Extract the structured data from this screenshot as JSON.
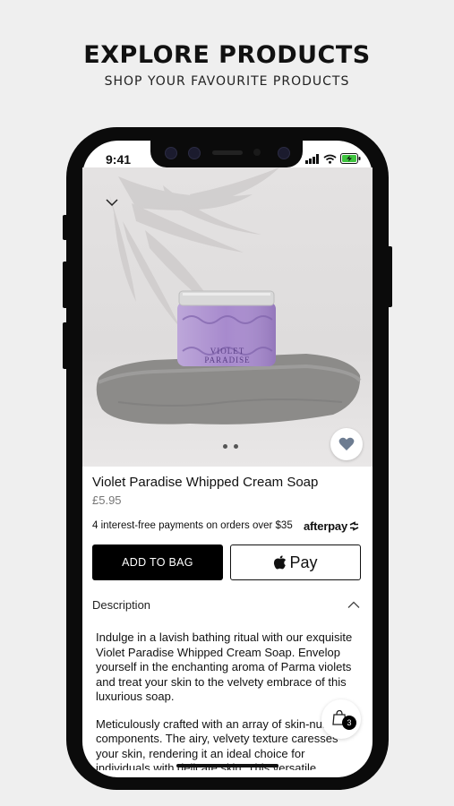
{
  "header": {
    "title": "EXPLORE PRODUCTS",
    "subtitle": "SHOP YOUR FAVOURITE PRODUCTS"
  },
  "status_bar": {
    "time": "9:41"
  },
  "product": {
    "name": "Violet Paradise Whipped Cream Soap",
    "price": "£5.95",
    "jar_label": "VIOLET PARADISE",
    "image_page_count": 2,
    "favorite": false
  },
  "afterpay": {
    "text": "4 interest-free payments on orders over $35",
    "logo": "afterpay"
  },
  "buttons": {
    "add_to_bag": "ADD TO BAG",
    "apple_pay": "Pay"
  },
  "description": {
    "label": "Description",
    "paragraphs": [
      "Indulge in a lavish bathing ritual with our exquisite Violet Paradise Whipped Cream Soap. Envelop yourself in the enchanting aroma of Parma violets and treat your skin to the velvety embrace of this luxurious soap.",
      "Meticulously crafted with an array of skin-nurturing components. The airy, velvety texture caresses your skin, rendering it an ideal choice for individuals with delicate skin. This versatile"
    ]
  },
  "cart": {
    "count": "3"
  },
  "colors": {
    "background": "#efefef",
    "button_primary": "#000000",
    "jar_purple": "#9b7cc4"
  }
}
